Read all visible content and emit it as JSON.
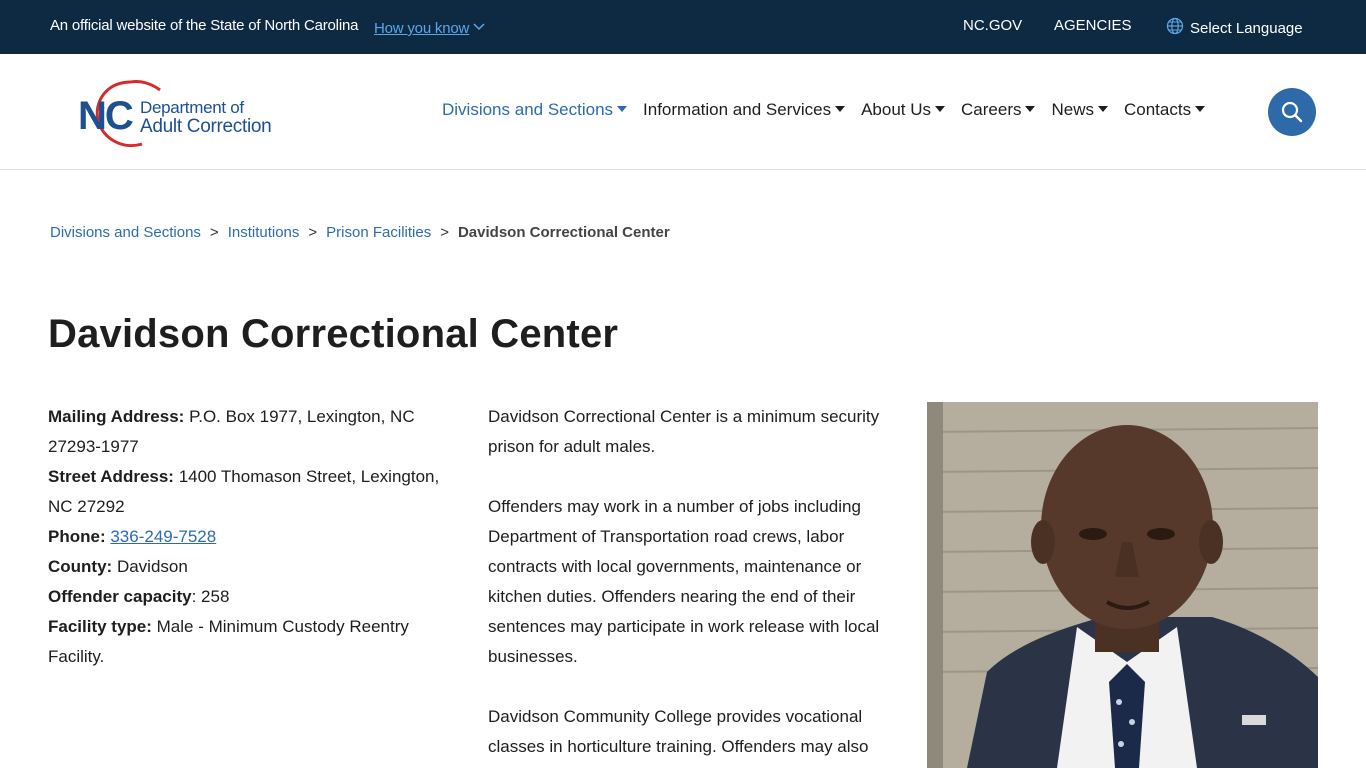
{
  "banner": {
    "official_text": "An official website of the State of North Carolina",
    "how_you_know": "How you know",
    "ncgov": "NC.GOV",
    "agencies": "AGENCIES",
    "language": "Select Language"
  },
  "logo": {
    "nc": "NC",
    "line1": "Department of",
    "line2": "Adult Correction"
  },
  "nav": {
    "items": [
      {
        "label": "Divisions and Sections"
      },
      {
        "label": "Information and Services"
      },
      {
        "label": "About Us"
      },
      {
        "label": "Careers"
      },
      {
        "label": "News"
      },
      {
        "label": "Contacts"
      }
    ]
  },
  "breadcrumb": {
    "items": [
      "Divisions and Sections",
      "Institutions",
      "Prison Facilities"
    ],
    "separator": ">",
    "current": "Davidson Correctional Center"
  },
  "page": {
    "title": "Davidson Correctional Center"
  },
  "info": {
    "mailing_label": "Mailing Address:",
    "mailing_value": " P.O. Box 1977, Lexington, NC 27293-1977",
    "street_label": "Street Address:",
    "street_value": " 1400 Thomason Street, Lexington, NC 27292",
    "phone_label": "Phone:",
    "phone_value": "336-249-7528",
    "county_label": "County:",
    "county_value": " Davidson",
    "capacity_label": "Offender capacity",
    "capacity_value": ": 258",
    "type_label": "Facility type:",
    "type_value": " Male - Minimum Custody Reentry Facility."
  },
  "description": {
    "p1": "Davidson Correctional Center is a minimum security prison for adult males.",
    "p2": "Offenders may work in a number of jobs including Department of Transportation road crews, labor contracts with local governments, maintenance or kitchen duties. Offenders nearing the end of their sentences may participate in work release with local businesses.",
    "p3": "Davidson Community College provides vocational classes in horticulture training. Offenders may also"
  },
  "colors": {
    "banner_bg": "#0e2a43",
    "link": "#2b6cb0",
    "search_bg": "#2e6aa8",
    "logo_blue": "#1d4f91",
    "logo_red": "#d52b2b"
  }
}
